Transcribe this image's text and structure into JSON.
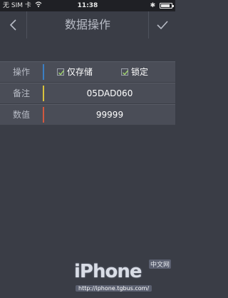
{
  "status_bar": {
    "carrier": "无 SIM 卡",
    "time": "11:38",
    "bluetooth": "✱",
    "battery_level": 0.85
  },
  "nav": {
    "title": "数据操作",
    "back_icon": "chevron-left-icon",
    "confirm_icon": "checkmark-icon"
  },
  "form": {
    "rows": [
      {
        "label": "操作",
        "accent": "#3b7fc4",
        "options": [
          {
            "label": "仅存储",
            "checked": true
          },
          {
            "label": "锁定",
            "checked": true
          }
        ]
      },
      {
        "label": "备注",
        "accent": "#d8c23c",
        "value": "05DAD060"
      },
      {
        "label": "数值",
        "accent": "#d2583f",
        "value": "99999"
      }
    ]
  },
  "watermark": {
    "logo": "iPhone",
    "tag": "中文网",
    "url": "http://iphone.tgbus.com/"
  }
}
